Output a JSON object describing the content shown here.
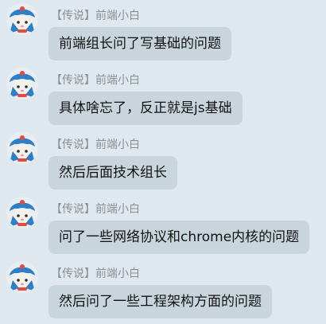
{
  "messages": [
    {
      "sender": "【传说】前端小白",
      "text": "前端组长问了写基础的问题"
    },
    {
      "sender": "【传说】前端小白",
      "text": "具体啥忘了，反正就是js基础"
    },
    {
      "sender": "【传说】前端小白",
      "text": "然后后面技术组长"
    },
    {
      "sender": "【传说】前端小白",
      "text": "问了一些网络协议和chrome内核的问题"
    },
    {
      "sender": "【传说】前端小白",
      "text": "然后问了一些工程架构方面的问题"
    }
  ],
  "colors": {
    "background": "#dfe8ee",
    "bubble": "#c9d5dd",
    "sender_text": "#8a8f94",
    "message_text": "#111111"
  }
}
